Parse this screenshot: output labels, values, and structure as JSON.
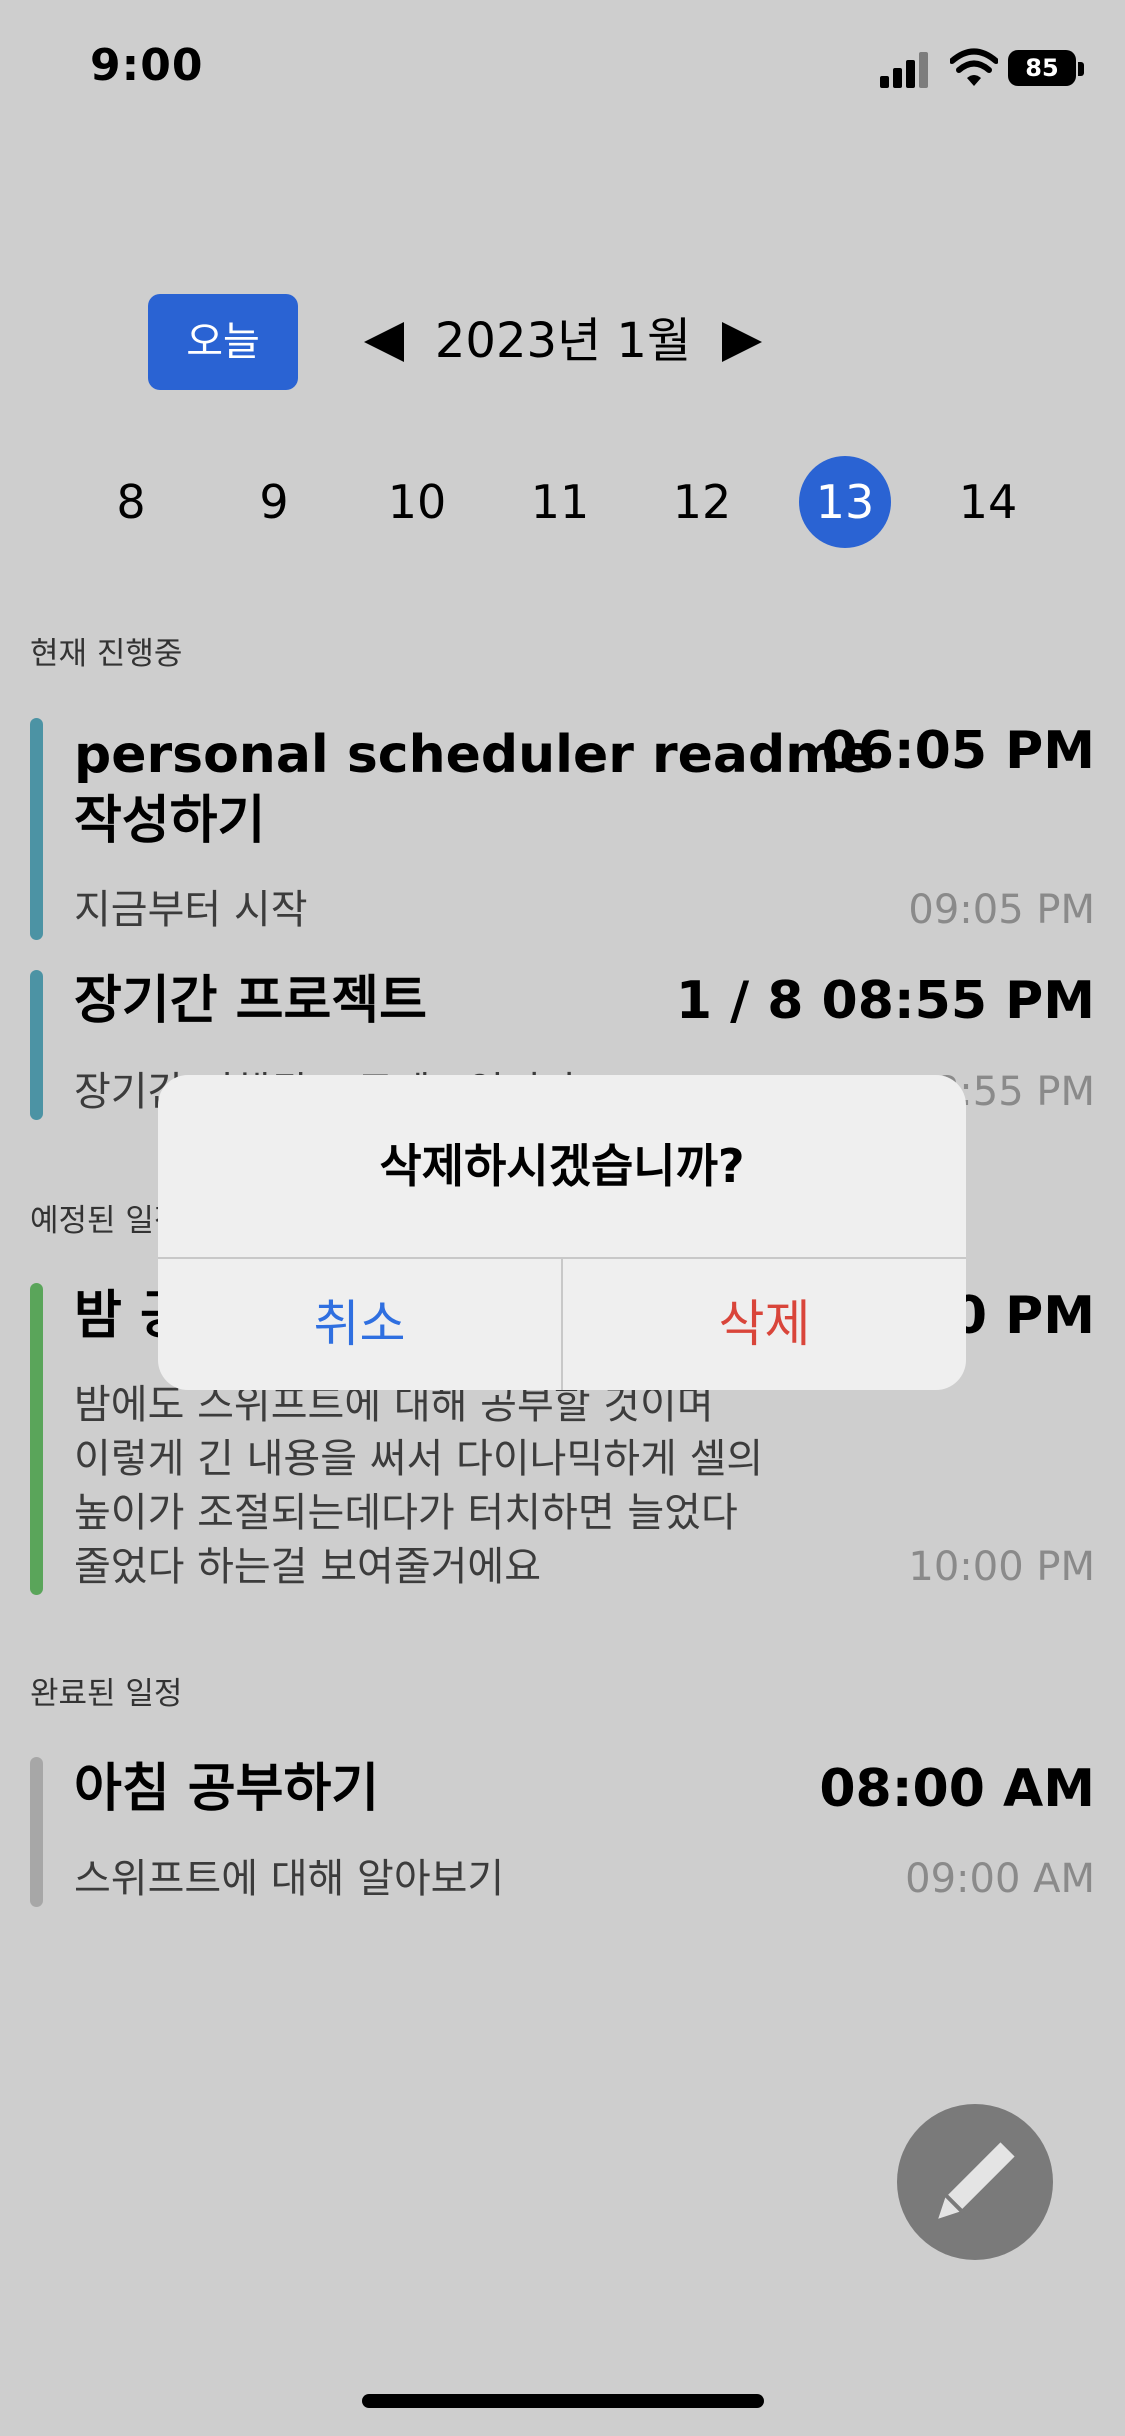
{
  "status_bar": {
    "time": "9:00",
    "battery": "85"
  },
  "header": {
    "today_label": "오늘",
    "month_title": "2023년 1월"
  },
  "week_days": [
    {
      "label": "8",
      "selected": false
    },
    {
      "label": "9",
      "selected": false
    },
    {
      "label": "10",
      "selected": false
    },
    {
      "label": "11",
      "selected": false
    },
    {
      "label": "12",
      "selected": false
    },
    {
      "label": "13",
      "selected": true
    },
    {
      "label": "14",
      "selected": false
    }
  ],
  "sections": {
    "in_progress": "현재 진행중",
    "scheduled": "예정된 일정",
    "completed": "완료된 일정"
  },
  "cards": [
    {
      "title": "personal scheduler readme\n작성하기",
      "start": "06:05 PM",
      "description": "지금부터 시작",
      "end": "09:05 PM",
      "color": "#4c93a4"
    },
    {
      "title": "장기간 프로젝트",
      "start": "1 / 8 08:55 PM",
      "description": "장기간 진행된 프로젝트입니다",
      "end": "1 / 18 08:55 PM",
      "color": "#4c93a4"
    },
    {
      "title": "밤 공부하기",
      "start": "09:00 PM",
      "description": "밤에도 스위프트에 대해 공부할 것이며\n이렇게 긴 내용을 써서 다이나믹하게 셀의\n높이가 조절되는데다가 터치하면 늘었다\n줄었다 하는걸 보여줄거에요",
      "end": "10:00 PM",
      "color": "#5aa55a"
    },
    {
      "title": "아침 공부하기",
      "start": "08:00 AM",
      "description": "스위프트에 대해 알아보기",
      "end": "09:00 AM",
      "color": "#a7a7a7"
    }
  ],
  "alert": {
    "title": "삭제하시겠습니까?",
    "cancel_label": "취소",
    "delete_label": "삭제"
  },
  "colors": {
    "accent": "#2a63d3",
    "cancel": "#2f6fe0",
    "destructive": "#d9453a"
  },
  "icons": {
    "fab": "pencil-icon",
    "prev": "triangle-left-icon",
    "next": "triangle-right-icon"
  }
}
